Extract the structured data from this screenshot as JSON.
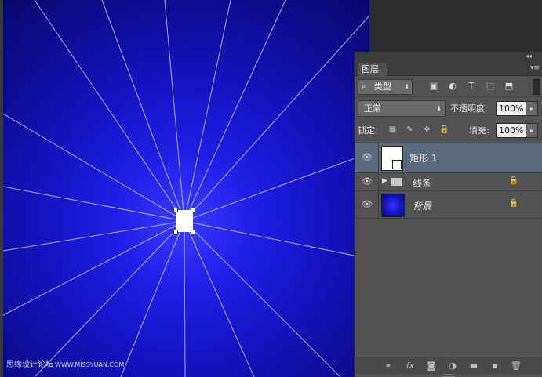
{
  "canvas": {
    "watermark_primary": "思缘设计论坛",
    "watermark_secondary": "WWW.MISSYUAN.COM"
  },
  "panel": {
    "tab_label": "图层",
    "collapse_icon": "◂◂",
    "close_icon": "✕",
    "menu_icon": "▾≡",
    "filter": {
      "search_icon": "⌕",
      "kind_label": "类型",
      "arrow": "⬍",
      "icons": [
        "image-filter-icon",
        "adjustment-filter-icon",
        "type-filter-icon",
        "shape-filter-icon",
        "smartobject-filter-icon"
      ],
      "icon_glyphs": [
        "▣",
        "◐",
        "T",
        "⬚",
        "⬒"
      ]
    },
    "blend_mode": "正常",
    "blend_arrow": "⬍",
    "opacity_label": "不透明度:",
    "opacity_value": "100%",
    "lock_label": "锁定:",
    "lock_icons": [
      "lock-transparent-icon",
      "lock-image-icon",
      "lock-position-icon",
      "lock-all-icon"
    ],
    "lock_glyphs": [
      "▦",
      "✎",
      "✥",
      "🔒"
    ],
    "fill_label": "填充:",
    "fill_value": "100%",
    "dropdown_arrow": "▸",
    "layers": [
      {
        "name": "矩形 1",
        "visible": true,
        "selected": true,
        "eye": "👁"
      },
      {
        "name": "线条",
        "visible": true,
        "selected": false,
        "eye": "👁",
        "expander": "▶",
        "locked": true,
        "lock": "🔒"
      },
      {
        "name": "背景",
        "visible": true,
        "selected": false,
        "eye": "👁",
        "locked": true,
        "lock": "🔒"
      }
    ],
    "bottom_icons": [
      "link-layers-icon",
      "fx-icon",
      "add-mask-icon",
      "new-adjustment-icon",
      "new-group-icon",
      "new-layer-icon",
      "delete-layer-icon"
    ],
    "bottom_glyphs": [
      "⚭",
      "fx",
      "◙",
      "◑",
      "▬",
      "▪",
      "🗑"
    ]
  }
}
